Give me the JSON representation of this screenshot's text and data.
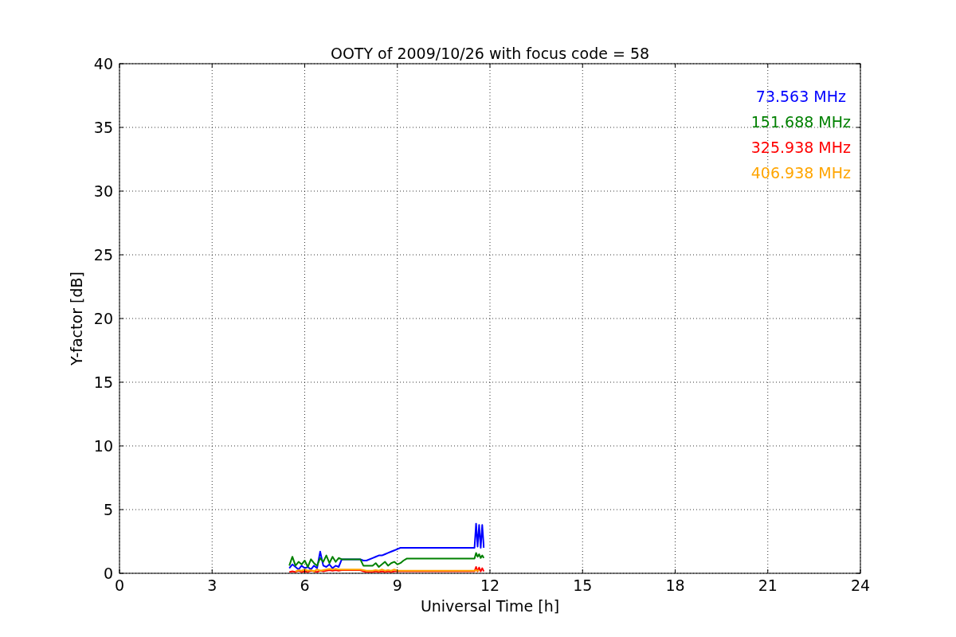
{
  "figure": {
    "chart_data": {
      "type": "line",
      "title": "OOTY of 2009/10/26 with focus code = 58",
      "xlabel": "Universal Time [h]",
      "ylabel": "Y-factor [dB]",
      "x": [
        5.5,
        5.6,
        5.7,
        5.8,
        5.9,
        6.0,
        6.1,
        6.2,
        6.3,
        6.4,
        6.5,
        6.6,
        6.7,
        6.8,
        6.9,
        7.0,
        7.1,
        7.2,
        7.8,
        7.9,
        8.0,
        8.2,
        8.3,
        8.4,
        8.5,
        8.6,
        8.7,
        8.8,
        8.9,
        9.0,
        9.1,
        9.2,
        9.3,
        11.5,
        11.55,
        11.6,
        11.65,
        11.7,
        11.75,
        11.8
      ],
      "series": [
        {
          "name": "73.563 MHz",
          "color": "#0000ff",
          "values": [
            0.4,
            0.7,
            0.5,
            0.3,
            0.6,
            0.4,
            0.5,
            0.3,
            0.6,
            0.4,
            1.7,
            0.6,
            0.5,
            0.7,
            0.4,
            0.6,
            0.5,
            1.1,
            1.1,
            1.0,
            1.0,
            1.2,
            1.3,
            1.4,
            1.4,
            1.5,
            1.6,
            1.7,
            1.8,
            1.9,
            2.0,
            2.0,
            2.0,
            2.0,
            3.9,
            2.1,
            3.8,
            2.0,
            3.8,
            2.0
          ]
        },
        {
          "name": "151.688 MHz",
          "color": "#008000",
          "values": [
            0.6,
            1.3,
            0.6,
            0.9,
            0.7,
            1.0,
            0.5,
            1.1,
            0.8,
            0.6,
            1.2,
            0.9,
            1.4,
            0.8,
            1.3,
            0.9,
            1.2,
            1.1,
            1.1,
            0.6,
            0.6,
            0.6,
            0.8,
            0.5,
            0.7,
            0.9,
            0.6,
            0.8,
            0.9,
            0.7,
            0.8,
            1.0,
            1.15,
            1.15,
            1.6,
            1.3,
            1.5,
            1.2,
            1.4,
            1.2
          ]
        },
        {
          "name": "325.938 MHz",
          "color": "#ff0000",
          "values": [
            0.1,
            0.15,
            0.1,
            0.2,
            0.1,
            0.15,
            0.1,
            0.2,
            0.15,
            0.1,
            0.2,
            0.15,
            0.2,
            0.25,
            0.2,
            0.25,
            0.2,
            0.25,
            0.25,
            0.15,
            0.1,
            0.1,
            0.15,
            0.1,
            0.15,
            0.1,
            0.15,
            0.1,
            0.15,
            0.15,
            0.15,
            0.15,
            0.15,
            0.15,
            0.5,
            0.15,
            0.45,
            0.15,
            0.4,
            0.15
          ]
        },
        {
          "name": "406.938 MHz",
          "color": "#ffa500",
          "values": [
            null,
            null,
            0.15,
            0.25,
            0.2,
            0.3,
            0.2,
            0.25,
            0.15,
            0.3,
            0.2,
            0.25,
            0.3,
            0.35,
            0.3,
            0.35,
            0.3,
            0.3,
            0.3,
            0.25,
            0.2,
            0.2,
            0.25,
            0.2,
            0.3,
            0.2,
            0.25,
            0.2,
            0.3,
            0.2,
            0.2,
            0.2,
            0.2,
            0.2,
            0.25,
            0.2,
            0.25,
            null,
            null,
            null
          ]
        }
      ],
      "xlim": [
        0,
        24
      ],
      "ylim": [
        0,
        40
      ],
      "grid": true,
      "xticks": [
        0,
        3,
        6,
        9,
        12,
        15,
        18,
        21,
        24
      ],
      "yticks": [
        0,
        5,
        10,
        15,
        20,
        25,
        30,
        35,
        40
      ]
    }
  }
}
